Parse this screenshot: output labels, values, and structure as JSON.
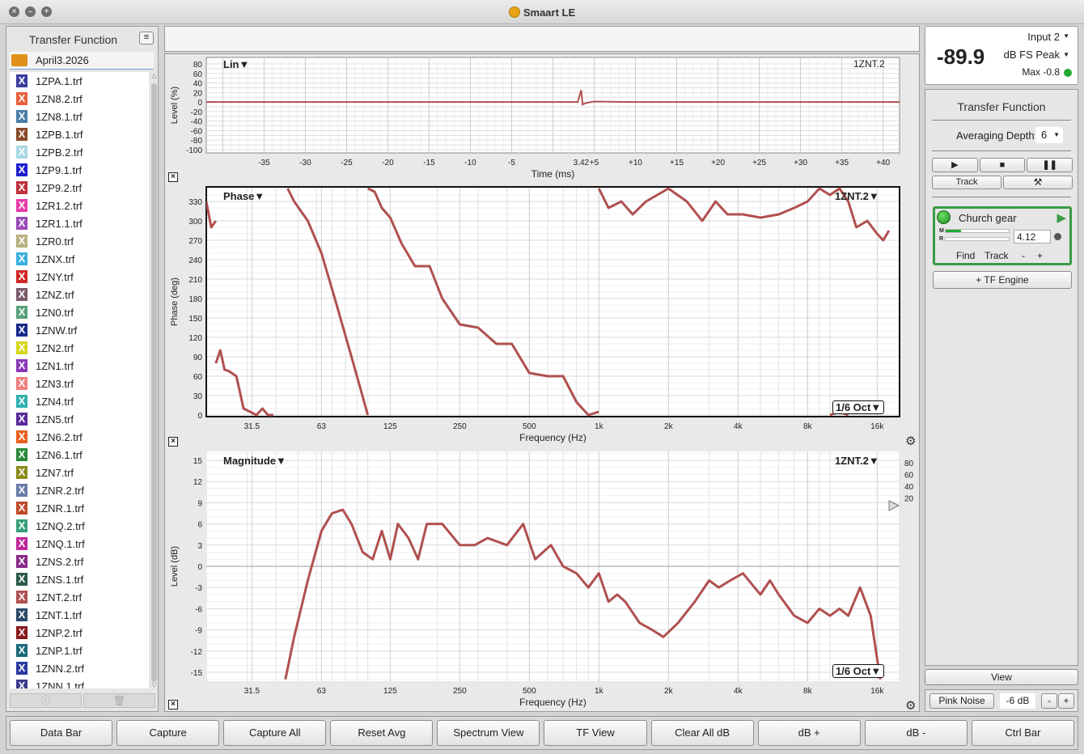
{
  "window": {
    "title": "Smaart LE"
  },
  "left_panel": {
    "title": "Transfer Function",
    "folder": "April3.2026",
    "files": [
      {
        "name": "1ZPA.1.trf",
        "color": "#3b3f9e"
      },
      {
        "name": "1ZN8.2.trf",
        "color": "#e8613c"
      },
      {
        "name": "1ZN8.1.trf",
        "color": "#4a7fa8"
      },
      {
        "name": "1ZPB.1.trf",
        "color": "#8a4a2a"
      },
      {
        "name": "1ZPB.2.trf",
        "color": "#a8d8e4"
      },
      {
        "name": "1ZP9.1.trf",
        "color": "#1f1fd0"
      },
      {
        "name": "1ZP9.2.trf",
        "color": "#c0303a"
      },
      {
        "name": "1ZR1.2.trf",
        "color": "#e83ca8"
      },
      {
        "name": "1ZR1.1.trf",
        "color": "#9a4ab8"
      },
      {
        "name": "1ZR0.trf",
        "color": "#b8b080"
      },
      {
        "name": "1ZNX.trf",
        "color": "#3ab0e0"
      },
      {
        "name": "1ZNY.trf",
        "color": "#d02828"
      },
      {
        "name": "1ZNZ.trf",
        "color": "#7a5a6a"
      },
      {
        "name": "1ZN0.trf",
        "color": "#5aa07a"
      },
      {
        "name": "1ZNW.trf",
        "color": "#1a2a8a"
      },
      {
        "name": "1ZN2.trf",
        "color": "#d8d820"
      },
      {
        "name": "1ZN1.trf",
        "color": "#8a3ab8"
      },
      {
        "name": "1ZN3.trf",
        "color": "#f08080"
      },
      {
        "name": "1ZN4.trf",
        "color": "#30b0b0"
      },
      {
        "name": "1ZN5.trf",
        "color": "#5a2a9a"
      },
      {
        "name": "1ZN6.2.trf",
        "color": "#e86020"
      },
      {
        "name": "1ZN6.1.trf",
        "color": "#2a8a3a"
      },
      {
        "name": "1ZN7.trf",
        "color": "#8a8a1a"
      },
      {
        "name": "1ZNR.2.trf",
        "color": "#6a7aa8"
      },
      {
        "name": "1ZNR.1.trf",
        "color": "#c04a2a"
      },
      {
        "name": "1ZNQ.2.trf",
        "color": "#3aa07a"
      },
      {
        "name": "1ZNQ.1.trf",
        "color": "#c02a9a"
      },
      {
        "name": "1ZNS.2.trf",
        "color": "#8a2a8a"
      },
      {
        "name": "1ZNS.1.trf",
        "color": "#2a5a4a"
      },
      {
        "name": "1ZNT.2.trf",
        "color": "#b05050"
      },
      {
        "name": "1ZNT.1.trf",
        "color": "#2a4a6a"
      },
      {
        "name": "1ZNP.2.trf",
        "color": "#8a1a1a"
      },
      {
        "name": "1ZNP.1.trf",
        "color": "#1a6a7a"
      },
      {
        "name": "1ZNN.2.trf",
        "color": "#2a3aa0"
      },
      {
        "name": "1ZNN.1.trf",
        "color": "#3a3a8a"
      }
    ],
    "footer_icons": [
      "info-icon",
      "trash-icon"
    ]
  },
  "meter": {
    "value": "-89.9",
    "input": "Input 2",
    "unit": "dB FS Peak",
    "max": "Max -0.8",
    "status_color": "#22aa33"
  },
  "right_panel": {
    "title": "Transfer Function",
    "averaging_label": "Averaging Depth:",
    "averaging_value": "6",
    "track_label": "Track",
    "measurement": {
      "name": "Church gear",
      "delay": "4.12",
      "find_label": "Find",
      "track_label": "Track",
      "minus": "-",
      "plus": "+",
      "m_level": 0.24,
      "r_level": 0.0,
      "color": "#3a9b45"
    },
    "tf_engine_label": "+ TF Engine",
    "view_label": "View",
    "pink_noise_label": "Pink Noise",
    "pink_noise_level": "-6 dB",
    "minus": "-",
    "plus": "+"
  },
  "plots": {
    "impulse": {
      "mode": "Lin▼",
      "trace": "1ZNT.2",
      "ylabel": "Level (%)",
      "xlabel": "Time (ms)",
      "yticks": [
        "80",
        "60",
        "40",
        "20",
        "0",
        "-20",
        "-40",
        "-60",
        "-80",
        "-100"
      ],
      "xticks": [
        "-35",
        "-30",
        "-25",
        "-20",
        "-15",
        "-10",
        "-5",
        "3.42",
        "+5",
        "+10",
        "+15",
        "+20",
        "+25",
        "+30",
        "+35",
        "+40"
      ]
    },
    "phase": {
      "mode": "Phase▼",
      "trace": "1ZNT.2▼",
      "ylabel": "Phase (deg)",
      "xlabel": "Frequency (Hz)",
      "yticks": [
        "330",
        "300",
        "270",
        "240",
        "210",
        "180",
        "150",
        "120",
        "90",
        "60",
        "30",
        "0"
      ],
      "xticks": [
        "31.5",
        "63",
        "125",
        "250",
        "500",
        "1k",
        "2k",
        "4k",
        "8k",
        "16k"
      ],
      "smoothing": "1/6 Oct▼"
    },
    "magnitude": {
      "mode": "Magnitude▼",
      "trace": "1ZNT.2▼",
      "ylabel": "Level (dB)",
      "xlabel": "Frequency (Hz)",
      "yticks": [
        "15",
        "12",
        "9",
        "6",
        "3",
        "0",
        "-3",
        "-6",
        "-9",
        "-12",
        "-15"
      ],
      "xticks": [
        "31.5",
        "63",
        "125",
        "250",
        "500",
        "1k",
        "2k",
        "4k",
        "8k",
        "16k"
      ],
      "coherence_ticks": [
        "80",
        "60",
        "40",
        "20"
      ],
      "smoothing": "1/6 Oct▼"
    }
  },
  "chart_data": [
    {
      "type": "line",
      "title": "",
      "xlabel": "Time (ms)",
      "ylabel": "Level (%)",
      "xlim": [
        -40,
        42
      ],
      "ylim": [
        -100,
        80
      ],
      "series": [
        {
          "name": "1ZNT.2",
          "x": [
            -42,
            3,
            3.42,
            3.6,
            4,
            5,
            10,
            42
          ],
          "y": [
            0,
            0,
            25,
            -5,
            -2,
            1,
            0,
            0
          ]
        }
      ]
    },
    {
      "type": "line",
      "title": "",
      "xlabel": "Frequency (Hz)",
      "ylabel": "Phase (deg)",
      "x_scale": "log",
      "ylim": [
        0,
        350
      ],
      "series": [
        {
          "name": "1ZNT.2",
          "segments": [
            {
              "x": [
                20,
                21,
                22
              ],
              "y": [
                330,
                290,
                300
              ]
            },
            {
              "x": [
                22,
                23,
                24,
                25,
                27,
                29,
                33,
                35,
                37,
                39
              ],
              "y": [
                80,
                100,
                70,
                68,
                60,
                10,
                0,
                10,
                0,
                0
              ]
            },
            {
              "x": [
                45,
                48,
                55,
                63,
                72,
                85,
                100
              ],
              "y": [
                350,
                330,
                300,
                250,
                180,
                90,
                0
              ]
            },
            {
              "x": [
                100,
                107,
                115,
                125,
                140,
                160,
                185,
                210,
                250,
                300,
                360,
                420,
                500,
                600,
                700,
                800,
                900,
                1000
              ],
              "y": [
                350,
                345,
                320,
                305,
                265,
                230,
                230,
                180,
                140,
                135,
                110,
                110,
                65,
                60,
                60,
                20,
                0,
                5
              ]
            },
            {
              "x": [
                1000,
                1100,
                1250,
                1400,
                1600,
                2000,
                2400,
                2800,
                3200,
                3600,
                4200,
                5000,
                6000,
                7000,
                8000,
                9000,
                10000,
                11000,
                12000,
                13000,
                14500,
                16000,
                17000,
                18000
              ],
              "y": [
                350,
                320,
                330,
                310,
                330,
                350,
                330,
                300,
                330,
                310,
                310,
                305,
                310,
                320,
                330,
                350,
                340,
                350,
                330,
                290,
                300,
                280,
                270,
                285
              ]
            },
            {
              "x": [
                10000,
                11000,
                12000
              ],
              "y": [
                0,
                5,
                0
              ]
            }
          ]
        }
      ]
    },
    {
      "type": "line",
      "title": "",
      "xlabel": "Frequency (Hz)",
      "ylabel": "Level (dB)",
      "x_scale": "log",
      "ylim": [
        -16,
        16
      ],
      "series": [
        {
          "name": "1ZNT.2",
          "x": [
            44,
            48,
            55,
            63,
            70,
            78,
            85,
            95,
            105,
            115,
            125,
            135,
            150,
            165,
            180,
            210,
            250,
            290,
            330,
            400,
            470,
            530,
            620,
            700,
            800,
            900,
            1000,
            1100,
            1200,
            1300,
            1500,
            1700,
            1900,
            2200,
            2600,
            3000,
            3300,
            3700,
            4200,
            5000,
            5500,
            6000,
            7000,
            8000,
            9000,
            10000,
            11000,
            12000,
            13500,
            15000,
            16500
          ],
          "y": [
            -16,
            -10,
            -2,
            5,
            7.5,
            8,
            6,
            2,
            1,
            5,
            1,
            6,
            4,
            1,
            6,
            6,
            3,
            3,
            4,
            3,
            6,
            1,
            3,
            0,
            -1,
            -3,
            -1,
            -5,
            -4,
            -5,
            -8,
            -9,
            -10,
            -8,
            -5,
            -2,
            -3,
            -2,
            -1,
            -4,
            -2,
            -4,
            -7,
            -8,
            -6,
            -7,
            -6,
            -7,
            -3,
            -7,
            -16
          ]
        }
      ],
      "coherence_ticks": [
        80,
        60,
        40,
        20
      ]
    }
  ],
  "bottom_bar": [
    "Data Bar",
    "Capture",
    "Capture All",
    "Reset Avg",
    "Spectrum View",
    "TF View",
    "Clear All dB",
    "dB +",
    "dB -",
    "Ctrl Bar"
  ]
}
